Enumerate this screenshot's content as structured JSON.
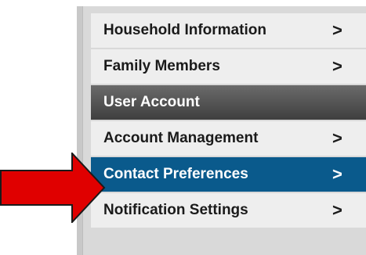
{
  "menu": {
    "items": [
      {
        "label": "Household Information",
        "chevron": ">"
      },
      {
        "label": "Family Members",
        "chevron": ">"
      }
    ],
    "section_header": "User Account",
    "section_items": [
      {
        "label": "Account Management",
        "chevron": ">"
      },
      {
        "label": "Contact Preferences",
        "chevron": ">",
        "active": true
      },
      {
        "label": "Notification Settings",
        "chevron": ">"
      }
    ]
  },
  "colors": {
    "active_bg": "#0a5a8c",
    "item_bg": "#eeeeee",
    "header_bg": "#4a4a4a",
    "arrow_red": "#e00000"
  },
  "icons": {
    "pointer": "red-arrow-icon",
    "chevron": "chevron-right-icon"
  }
}
